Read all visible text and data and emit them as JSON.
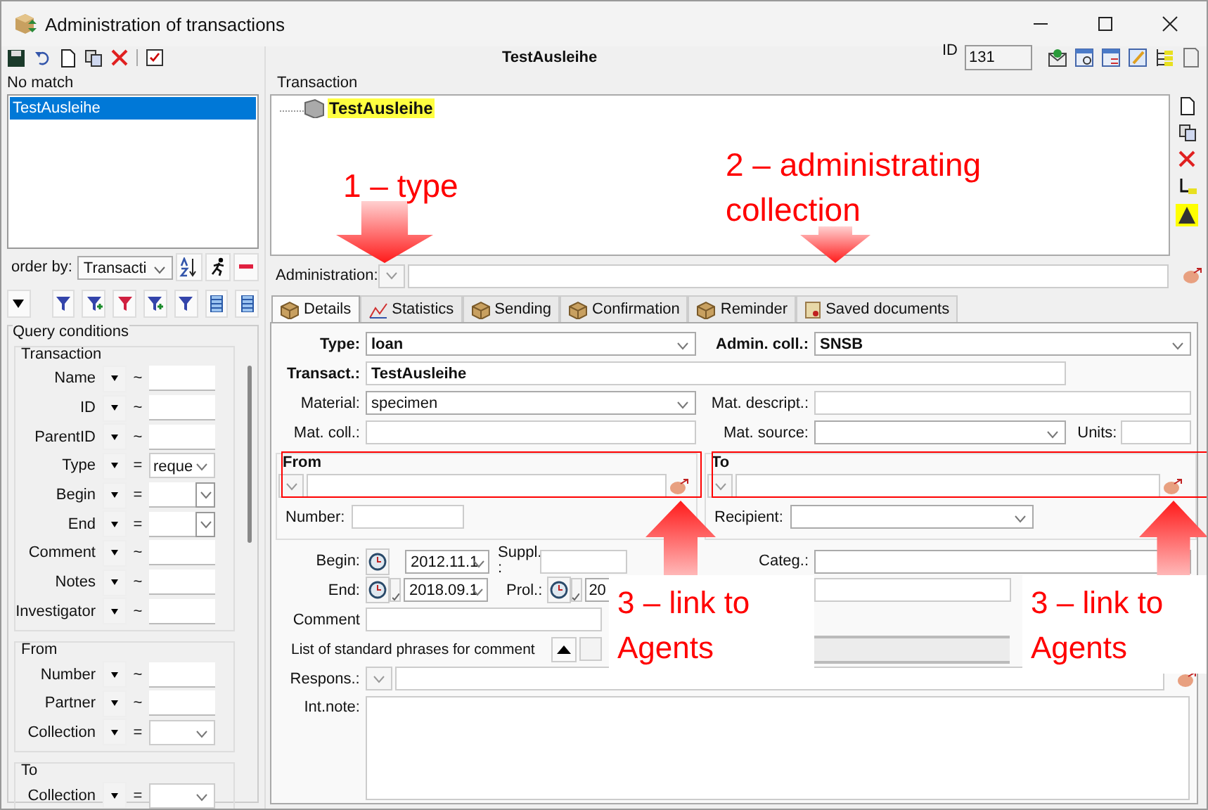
{
  "window": {
    "title": "Administration of transactions"
  },
  "list": {
    "status": "No match",
    "items": [
      {
        "label": "TestAusleihe",
        "selected": true
      }
    ]
  },
  "order_by": {
    "label": "order by:",
    "value": "Transacti"
  },
  "query": {
    "title": "Query conditions",
    "groups": [
      {
        "title": "Transaction",
        "rows": [
          {
            "label": "Name",
            "operator": "~",
            "kind": "text"
          },
          {
            "label": "ID",
            "operator": "~",
            "kind": "text"
          },
          {
            "label": "ParentID",
            "operator": "~",
            "kind": "text"
          },
          {
            "label": "Type",
            "operator": "=",
            "kind": "select",
            "value": "reque"
          },
          {
            "label": "Begin",
            "operator": "=",
            "kind": "date"
          },
          {
            "label": "End",
            "operator": "=",
            "kind": "date"
          },
          {
            "label": "Comment",
            "operator": "~",
            "kind": "text"
          },
          {
            "label": "Notes",
            "operator": "~",
            "kind": "text"
          },
          {
            "label": "Investigator",
            "operator": "~",
            "kind": "text"
          }
        ]
      },
      {
        "title": "From",
        "rows": [
          {
            "label": "Number",
            "operator": "~",
            "kind": "text"
          },
          {
            "label": "Partner",
            "operator": "~",
            "kind": "text"
          },
          {
            "label": "Collection",
            "operator": "=",
            "kind": "select"
          }
        ]
      },
      {
        "title": "To",
        "rows": [
          {
            "label": "Collection",
            "operator": "=",
            "kind": "select"
          }
        ]
      }
    ]
  },
  "header": {
    "title": "TestAusleihe",
    "id_label": "ID",
    "id_value": "131"
  },
  "tree": {
    "title": "Transaction",
    "root": "TestAusleihe"
  },
  "administration": {
    "label": "Administration:"
  },
  "tabs": [
    {
      "label": "Details",
      "selected": true
    },
    {
      "label": "Statistics",
      "selected": false
    },
    {
      "label": "Sending",
      "selected": false
    },
    {
      "label": "Confirmation",
      "selected": false
    },
    {
      "label": "Reminder",
      "selected": false
    },
    {
      "label": "Saved documents",
      "selected": false
    }
  ],
  "details": {
    "type_label": "Type:",
    "type_value": "loan",
    "admin_label": "Admin. coll.:",
    "admin_value": "SNSB",
    "transact_label": "Transact.:",
    "transact_value": "TestAusleihe",
    "material_label": "Material:",
    "material_value": "specimen",
    "mat_descript_label": "Mat. descript.:",
    "mat_coll_label": "Mat. coll.:",
    "mat_source_label": "Mat. source:",
    "units_label": "Units:",
    "from_title": "From",
    "number_label": "Number:",
    "to_title": "To",
    "recipient_label": "Recipient:",
    "begin_label": "Begin:",
    "begin_value": "2012.11.1",
    "suppl_label": "Suppl. :",
    "categ_label": "Categ.:",
    "end_label": "End:",
    "end_value": "2018.09.1",
    "prol_label": "Prol.:",
    "prol_value": "20",
    "comment_label": "Comment",
    "phrases_label": "List of standard phrases for comment",
    "respons_label": "Respons.:",
    "int_note_label": "Int.note:"
  },
  "annotations": [
    {
      "text": "1 – type",
      "kind": "down"
    },
    {
      "text": "2 – administrating collection",
      "kind": "down"
    },
    {
      "text": "3 – link to Agents",
      "kind": "up"
    },
    {
      "text": "3 – link to Agents",
      "kind": "up"
    }
  ]
}
